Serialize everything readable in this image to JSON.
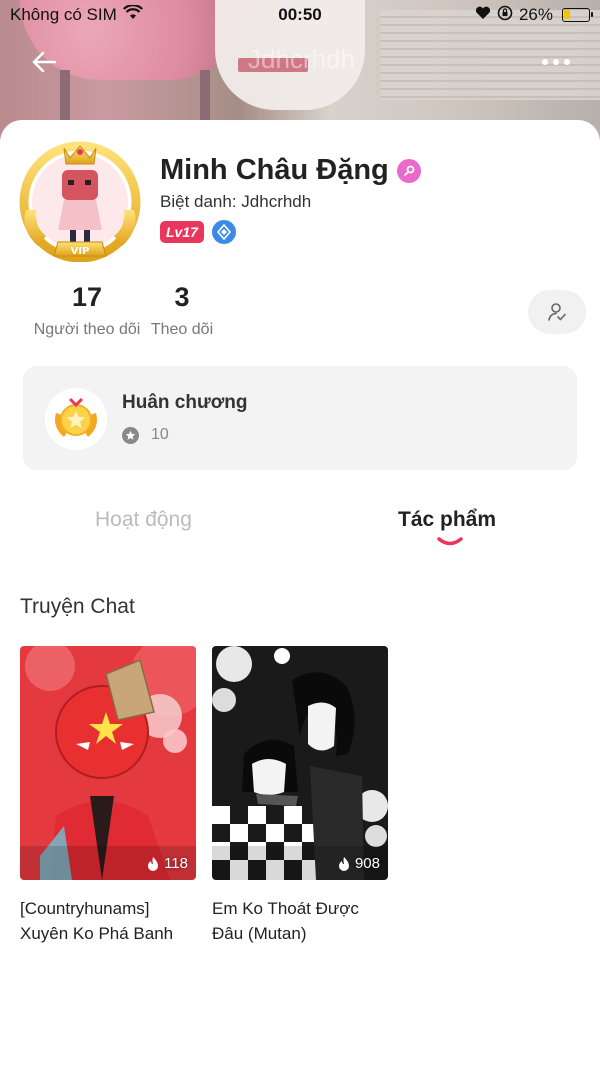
{
  "status_bar": {
    "carrier": "Không có SIM",
    "time": "00:50",
    "battery": "26%",
    "battery_level": 0.26,
    "battery_color": "#f5c400"
  },
  "header": {
    "faded_name": "Jdhcrhdh",
    "back_icon": "arrow-left-icon",
    "more_icon": "more-horizontal-icon"
  },
  "profile": {
    "name": "Minh Châu Đặng",
    "nickname": "Biệt danh: Jdhcrhdh",
    "level": "Lv17",
    "level_color": "#e8365d",
    "vip_label": "VIP"
  },
  "stats": {
    "followers_count": "17",
    "followers_label": "Người theo dõi",
    "following_count": "3",
    "following_label": "Theo dõi"
  },
  "medals": {
    "title": "Huân chương",
    "count": "10"
  },
  "tabs": [
    {
      "label": "Hoạt động",
      "active": false
    },
    {
      "label": "Tác phẩm",
      "active": true
    }
  ],
  "accent_color": "#e8365d",
  "section": {
    "title": "Truyện Chat",
    "stories": [
      {
        "title": "[Countryhunams] Xuyên Ko Phá Banh",
        "views": "118"
      },
      {
        "title": "Em Ko Thoát Được Đâu (Mutan)",
        "views": "908"
      }
    ]
  }
}
